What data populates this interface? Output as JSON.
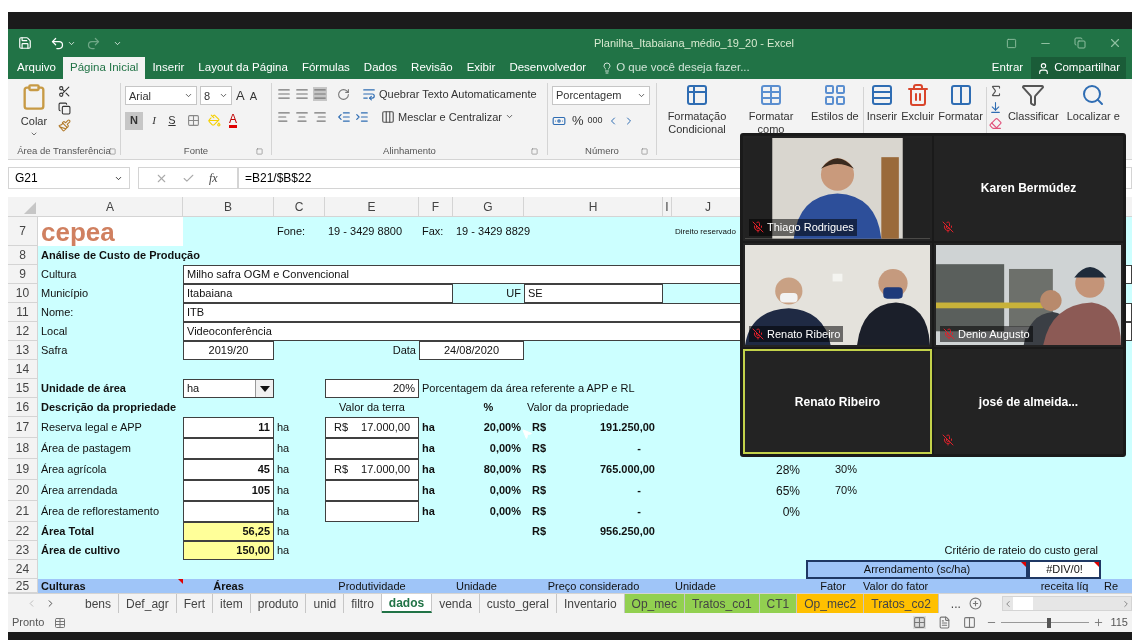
{
  "title_bar": {
    "title": "Planilha_Itabaiana_médio_19_20 - Excel"
  },
  "menu": {
    "tabs": [
      {
        "label": "Arquivo",
        "selected": false
      },
      {
        "label": "Página Inicial",
        "selected": true
      },
      {
        "label": "Inserir",
        "selected": false
      },
      {
        "label": "Layout da Página",
        "selected": false
      },
      {
        "label": "Fórmulas",
        "selected": false
      },
      {
        "label": "Dados",
        "selected": false
      },
      {
        "label": "Revisão",
        "selected": false
      },
      {
        "label": "Exibir",
        "selected": false
      },
      {
        "label": "Desenvolvedor",
        "selected": false
      }
    ],
    "tell_me": "O que você deseja fazer...",
    "sign_in": "Entrar",
    "share": "Compartilhar"
  },
  "ribbon": {
    "clipboard": {
      "paste": "Colar",
      "group": "Área de Transferência"
    },
    "font": {
      "name": "Arial",
      "size": "8",
      "grow": "A",
      "shrink": "A",
      "bold": "N",
      "bold_on": true,
      "italic": "I",
      "underline": "S",
      "font_color_label": "A",
      "group": "Fonte"
    },
    "alignment": {
      "wrap": "Quebrar Texto Automaticamente",
      "merge": "Mesclar e Centralizar",
      "group": "Alinhamento"
    },
    "number": {
      "format": "Porcentagem",
      "percent": "%",
      "thousands": "000",
      "group": "Número"
    },
    "styles": [
      "Formatação Condicional",
      "Formatar como",
      "Estilos de"
    ],
    "cells": [
      "Inserir",
      "Excluir",
      "Formatar"
    ],
    "editing": [
      "Classificar",
      "Localizar e"
    ]
  },
  "formula_bar": {
    "cell": "G21",
    "fx": "fx",
    "formula": "=B21/$B$22"
  },
  "sheet": {
    "columns": [
      "A",
      "B",
      "C",
      "E",
      "F",
      "G",
      "H",
      "I",
      "J"
    ],
    "rows": [
      {
        "number": "7",
        "kind": "logo",
        "cells": [
          {
            "kind": "logo",
            "text": "cepea"
          },
          "",
          {
            "kind": "text",
            "text": "Fone:"
          },
          {
            "kind": "text",
            "text": "19 - 3429 8800"
          },
          {
            "kind": "text",
            "text": "Fax:"
          },
          {
            "kind": "text",
            "text": "19 - 3429 8829"
          },
          null,
          "",
          {
            "kind": "fine",
            "text": "Direito reservado"
          }
        ]
      },
      {
        "number": "8",
        "kind": "plain",
        "cells": [
          {
            "kind": "heading",
            "text": "Análise de Custo de Produção"
          },
          null
        ]
      },
      {
        "number": "9",
        "kind": "plain",
        "cells": [
          {
            "kind": "text",
            "text": "Cultura"
          },
          {
            "kind": "entry",
            "text": "Milho safra OGM e Convencional"
          },
          null,
          null,
          null,
          null,
          null,
          null,
          null,
          null,
          null,
          null,
          null,
          null,
          null
        ]
      },
      {
        "number": "10",
        "kind": "plain",
        "cells": [
          {
            "kind": "text",
            "text": "Município"
          },
          {
            "kind": "entry",
            "text": "Itabaiana"
          },
          null,
          null,
          null,
          {
            "kind": "caption",
            "text": "UF"
          },
          {
            "kind": "entry",
            "text": "SE"
          }
        ]
      },
      {
        "number": "11",
        "kind": "plain",
        "cells": [
          {
            "kind": "text",
            "text": "Nome:"
          },
          {
            "kind": "entry",
            "text": "ITB"
          },
          null,
          null,
          null,
          null,
          null,
          null,
          null,
          null,
          null,
          null,
          null,
          null,
          null
        ]
      },
      {
        "number": "12",
        "kind": "plain",
        "cells": [
          {
            "kind": "text",
            "text": "Local"
          },
          {
            "kind": "entry",
            "text": "Videoconferência"
          },
          null,
          null,
          null,
          null,
          null,
          null,
          null,
          null,
          null,
          null,
          null,
          null,
          null
        ]
      },
      {
        "number": "13",
        "kind": "plain",
        "cells": [
          {
            "kind": "text",
            "text": "Safra"
          },
          {
            "kind": "date",
            "text": "2019/20"
          },
          "",
          {
            "kind": "caption",
            "text": "Data"
          },
          {
            "kind": "date",
            "text": "24/08/2020"
          },
          null
        ]
      },
      {
        "number": "14",
        "kind": "plain",
        "cells": []
      },
      {
        "number": "15",
        "kind": "plain",
        "cells": [
          {
            "kind": "heading",
            "text": "Unidade de área"
          },
          {
            "kind": "select",
            "text": "ha"
          },
          "",
          {
            "kind": "quantity",
            "text": "20%"
          },
          {
            "kind": "text",
            "text": "Porcentagem da área referente a APP e RL"
          },
          null,
          null
        ]
      },
      {
        "number": "16",
        "kind": "plain",
        "cells": [
          {
            "kind": "heading",
            "text": "Descrição da propriedade"
          },
          "",
          "",
          {
            "kind": "centered",
            "text": "Valor da terra"
          },
          "",
          {
            "kind": "centered-bold",
            "text": "%"
          },
          {
            "kind": "text",
            "text": "Valor da propriedade"
          }
        ]
      },
      {
        "number": "17",
        "kind": "wide",
        "cells": [
          {
            "kind": "text",
            "text": "Reserva legal e APP"
          },
          {
            "kind": "quantity-bold",
            "text": "11"
          },
          {
            "kind": "text",
            "text": "ha"
          },
          {
            "kind": "price",
            "prefix": "R$",
            "text": "17.000,00"
          },
          {
            "kind": "heading",
            "text": "ha"
          },
          {
            "kind": "rate",
            "text": "20,00%"
          },
          {
            "kind": "money",
            "prefix": "R$",
            "text": "191.250,00"
          }
        ]
      },
      {
        "number": "18",
        "kind": "wide",
        "cells": [
          {
            "kind": "text",
            "text": "Área de pastagem"
          },
          {
            "kind": "quantity"
          },
          {
            "kind": "text",
            "text": "ha"
          },
          {
            "kind": "quantity"
          },
          {
            "kind": "heading",
            "text": "ha"
          },
          {
            "kind": "rate",
            "text": "0,00%"
          },
          {
            "kind": "money",
            "prefix": "R$",
            "text": "-"
          }
        ]
      },
      {
        "number": "19",
        "kind": "wide",
        "cells": [
          {
            "kind": "text",
            "text": "Área agrícola"
          },
          {
            "kind": "quantity-bold",
            "text": "45"
          },
          {
            "kind": "text",
            "text": "ha"
          },
          {
            "kind": "price",
            "prefix": "R$",
            "text": "17.000,00"
          },
          {
            "kind": "heading",
            "text": "ha"
          },
          {
            "kind": "rate",
            "text": "80,00%"
          },
          {
            "kind": "money",
            "prefix": "R$",
            "text": "765.000,00"
          },
          "",
          "",
          {
            "kind": "caption-big",
            "text": "28%"
          },
          {
            "kind": "caption",
            "text": "30%"
          }
        ]
      },
      {
        "number": "20",
        "kind": "wide",
        "cells": [
          {
            "kind": "text",
            "text": "Área arrendada"
          },
          {
            "kind": "quantity-bold",
            "text": "105"
          },
          {
            "kind": "text",
            "text": "ha"
          },
          {
            "kind": "quantity"
          },
          {
            "kind": "heading",
            "text": "ha"
          },
          {
            "kind": "rate",
            "text": "0,00%"
          },
          {
            "kind": "money",
            "prefix": "R$",
            "text": "-"
          },
          "",
          "",
          {
            "kind": "caption-big",
            "text": "65%"
          },
          {
            "kind": "caption",
            "text": "70%"
          }
        ]
      },
      {
        "number": "21",
        "kind": "wide",
        "cells": [
          {
            "kind": "text",
            "text": "Área de reflorestamento"
          },
          {
            "kind": "quantity"
          },
          {
            "kind": "text",
            "text": "ha"
          },
          {
            "kind": "quantity"
          },
          {
            "kind": "heading",
            "text": "ha"
          },
          {
            "kind": "rate",
            "text": "0,00%"
          },
          {
            "kind": "money",
            "prefix": "R$",
            "text": "-"
          },
          "",
          "",
          {
            "kind": "caption-big",
            "text": "0%"
          }
        ]
      },
      {
        "number": "22",
        "kind": "plain",
        "cells": [
          {
            "kind": "heading",
            "text": "Área Total"
          },
          {
            "kind": "total",
            "text": "56,25"
          },
          {
            "kind": "text",
            "text": "ha"
          },
          "",
          "",
          "",
          {
            "kind": "money",
            "prefix": "R$",
            "text": "956.250,00"
          }
        ]
      },
      {
        "number": "23",
        "kind": "plain",
        "cells": [
          {
            "kind": "heading",
            "text": "Área de cultivo"
          },
          {
            "kind": "total",
            "text": "150,00"
          },
          {
            "kind": "text",
            "text": "ha"
          },
          "",
          "",
          "",
          "",
          "",
          "",
          "",
          {
            "kind": "caption",
            "text": "Critério de rateio do custo geral"
          },
          null,
          null,
          null
        ]
      },
      {
        "number": "24",
        "kind": "plain",
        "cells": [
          "",
          "",
          "",
          "",
          "",
          "",
          "",
          "",
          "",
          "",
          {
            "kind": "panel",
            "text": "Arrendamento (sc/ha)",
            "comment": true
          },
          null,
          null,
          {
            "kind": "result",
            "text": "#DIV/0!",
            "comment": true
          }
        ]
      },
      {
        "number": "25",
        "kind": "band",
        "cells": [
          {
            "kind": "heading",
            "text": "Culturas",
            "comment": true
          },
          {
            "kind": "centered-bold",
            "text": "Áreas"
          },
          "",
          {
            "kind": "centered",
            "text": "Produtividade"
          },
          "",
          {
            "kind": "text",
            "text": "Unidade"
          },
          {
            "kind": "centered",
            "text": "Preço considerado"
          },
          "",
          {
            "kind": "text",
            "text": "Unidade"
          },
          null,
          {
            "kind": "centered",
            "text": "Fator"
          },
          {
            "kind": "text",
            "text": "Valor do fator"
          },
          null,
          {
            "kind": "centered",
            "text": "receita líq"
          },
          {
            "kind": "text",
            "text": "Re"
          }
        ]
      }
    ]
  },
  "sheet_tabs": [
    {
      "label": "bens",
      "selected": false
    },
    {
      "label": "Def_agr",
      "selected": false
    },
    {
      "label": "Fert",
      "selected": false
    },
    {
      "label": "item",
      "selected": false
    },
    {
      "label": "produto",
      "selected": false
    },
    {
      "label": "unid",
      "selected": false
    },
    {
      "label": "filtro",
      "selected": false
    },
    {
      "label": "dados",
      "selected": true
    },
    {
      "label": "venda",
      "selected": false
    },
    {
      "label": "custo_geral",
      "selected": false
    },
    {
      "label": "Inventario",
      "selected": false
    },
    {
      "label": "Op_mec",
      "selected": false,
      "color": "#92d050"
    },
    {
      "label": "Tratos_co1",
      "selected": false,
      "color": "#92d050"
    },
    {
      "label": "CT1",
      "selected": false,
      "color": "#92d050"
    },
    {
      "label": "Op_mec2",
      "selected": false,
      "color": "#ffc000"
    },
    {
      "label": "Tratos_co2",
      "selected": false,
      "color": "#ffc000"
    }
  ],
  "more_tabs": "...",
  "status_bar": {
    "status": "Pronto",
    "zoom": {
      "level": 0.54
    },
    "zoom_text": "115"
  },
  "video_call": {
    "tiles": [
      {
        "name": "Thiago Rodrigues",
        "kind": "video",
        "muted": true,
        "speaking": false
      },
      {
        "name": "Karen Bermúdez",
        "kind": "name",
        "muted": true,
        "speaking": false
      },
      {
        "name": "Renato Ribeiro",
        "kind": "video",
        "muted": true,
        "speaking": false
      },
      {
        "name": "Denio Augusto",
        "kind": "video",
        "muted": true,
        "speaking": false
      },
      {
        "name": "Renato Ribeiro",
        "kind": "name",
        "muted": false,
        "speaking": true
      },
      {
        "name": "josé de almeida...",
        "kind": "name",
        "muted": true,
        "speaking": false
      }
    ]
  }
}
